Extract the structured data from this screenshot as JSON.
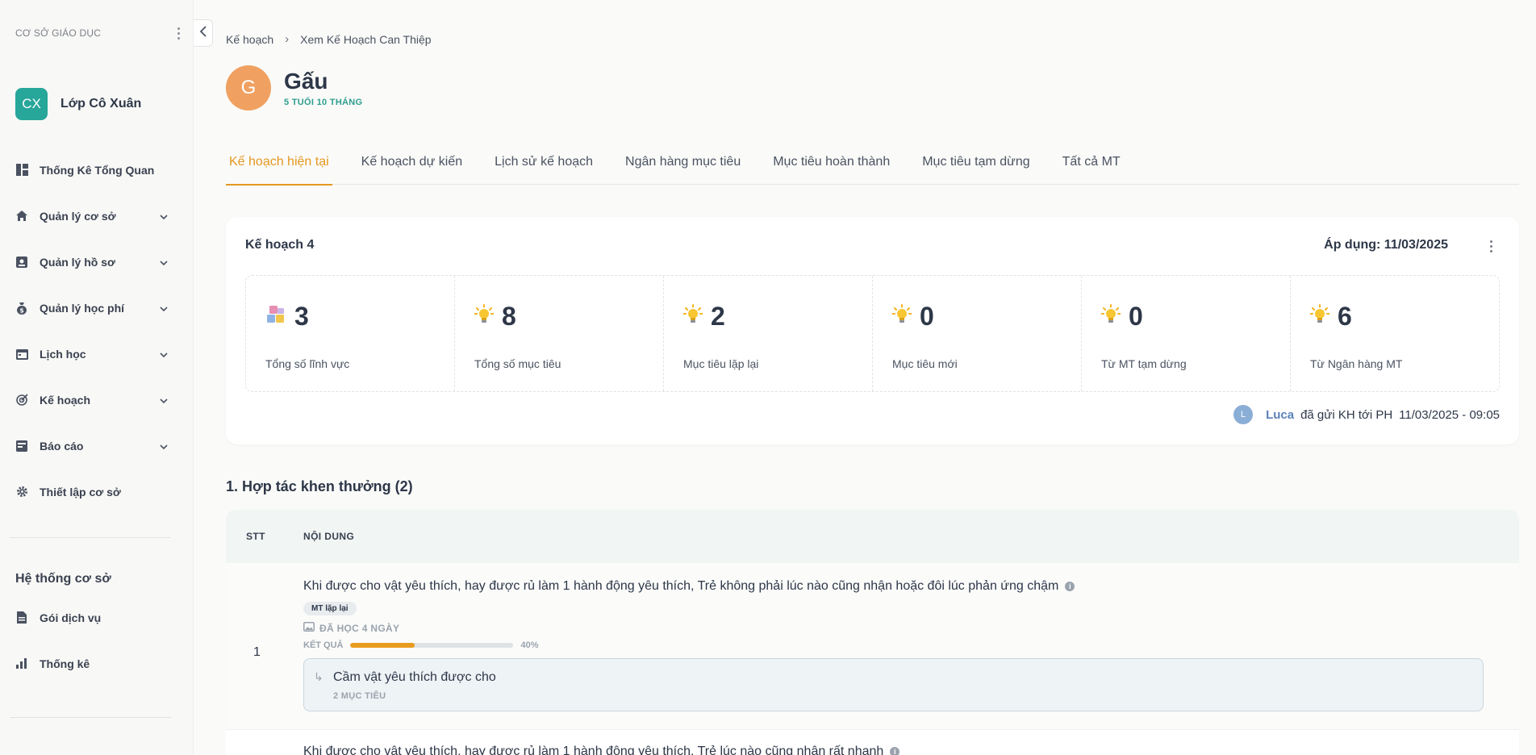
{
  "sidebar": {
    "header": "CƠ SỞ GIÁO DỤC",
    "org": {
      "initials": "CX",
      "name": "Lớp Cô Xuân",
      "color": "#27a69a"
    },
    "items": [
      {
        "label": "Thống Kê Tổng Quan",
        "icon": "dashboard-icon",
        "has_chevron": false
      },
      {
        "label": "Quản lý cơ sở",
        "icon": "home-icon",
        "has_chevron": true
      },
      {
        "label": "Quản lý hồ sơ",
        "icon": "id-card-icon",
        "has_chevron": true
      },
      {
        "label": "Quản lý học phí",
        "icon": "money-bag-icon",
        "has_chevron": true
      },
      {
        "label": "Lịch học",
        "icon": "calendar-icon",
        "has_chevron": true
      },
      {
        "label": "Kế hoạch",
        "icon": "target-icon",
        "has_chevron": true
      },
      {
        "label": "Báo cáo",
        "icon": "report-icon",
        "has_chevron": true
      },
      {
        "label": "Thiết lập cơ sở",
        "icon": "gear-icon",
        "has_chevron": false
      }
    ],
    "system_title": "Hệ thống cơ sở",
    "system_items": [
      {
        "label": "Gói dịch vụ",
        "icon": "document-icon"
      },
      {
        "label": "Thống kê",
        "icon": "bar-chart-icon"
      }
    ]
  },
  "breadcrumb": [
    "Kế hoạch",
    "Xem Kế Hoạch Can Thiệp"
  ],
  "profile": {
    "initial": "G",
    "name": "Gấu",
    "age": "5 TUỔI 10 THÁNG",
    "avatar_color": "#f0a060"
  },
  "tabs": [
    {
      "label": "Kế hoạch hiện tại",
      "active": true
    },
    {
      "label": "Kế hoạch dự kiến",
      "active": false
    },
    {
      "label": "Lịch sử kế hoạch",
      "active": false
    },
    {
      "label": "Ngân hàng mục tiêu",
      "active": false
    },
    {
      "label": "Mục tiêu hoàn thành",
      "active": false
    },
    {
      "label": "Mục tiêu tạm dừng",
      "active": false
    },
    {
      "label": "Tất cả MT",
      "active": false
    }
  ],
  "plan": {
    "title": "Kế hoạch 4",
    "applied": "Áp dụng: 11/03/2025",
    "stats": [
      {
        "value": "3",
        "label": "Tổng số lĩnh vực",
        "icon": "blocks-icon"
      },
      {
        "value": "8",
        "label": "Tổng số mục tiêu",
        "icon": "lightbulb-icon"
      },
      {
        "value": "2",
        "label": "Mục tiêu lặp lại",
        "icon": "lightbulb-icon"
      },
      {
        "value": "0",
        "label": "Mục tiêu mới",
        "icon": "lightbulb-icon"
      },
      {
        "value": "0",
        "label": "Từ MT tạm dừng",
        "icon": "lightbulb-icon"
      },
      {
        "value": "6",
        "label": "Từ Ngân hàng MT",
        "icon": "lightbulb-icon"
      }
    ],
    "sent": {
      "initial": "L",
      "user": "Luca",
      "text": "đã gửi KH tới PH",
      "time": "11/03/2025 - 09:05"
    }
  },
  "section": {
    "title": "1. Hợp tác khen thưởng (2)",
    "columns": {
      "stt": "STT",
      "content": "NỘI DUNG"
    },
    "rows": [
      {
        "stt": "1",
        "text": "Khi được cho vật yêu thích, hay được rủ làm 1 hành động yêu thích, Trẻ không phải lúc nào cũng nhận hoặc đôi lúc phản ứng chậm",
        "badge": "MT lặp lại",
        "learned": "ĐÃ HỌC 4 NGÀY",
        "result_label": "KẾT QUẢ",
        "result_pct": 40,
        "result_text": "40%",
        "sub_title": "Cầm vật yêu thích được cho",
        "sub_count": "2 MỤC TIÊU"
      },
      {
        "text": "Khi được cho vật yêu thích, hay được rủ làm 1 hành động yêu thích, Trẻ lúc nào cũng nhận rất nhanh"
      }
    ]
  },
  "colors": {
    "accent": "#e4981f",
    "teal": "#2e9e8e",
    "user_link": "#5b82b8"
  }
}
